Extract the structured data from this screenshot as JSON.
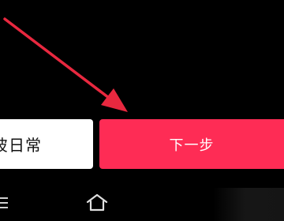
{
  "buttons": {
    "daily_label": "彼日常",
    "next_label": "下一步"
  },
  "colors": {
    "background": "#000000",
    "next_button": "#fe2c55",
    "daily_button": "#ffffff",
    "arrow": "#e8283f"
  },
  "nav": {
    "icons": [
      "menu-icon",
      "home-icon"
    ]
  },
  "annotation": {
    "icon": "red-arrow-annotation-icon"
  }
}
